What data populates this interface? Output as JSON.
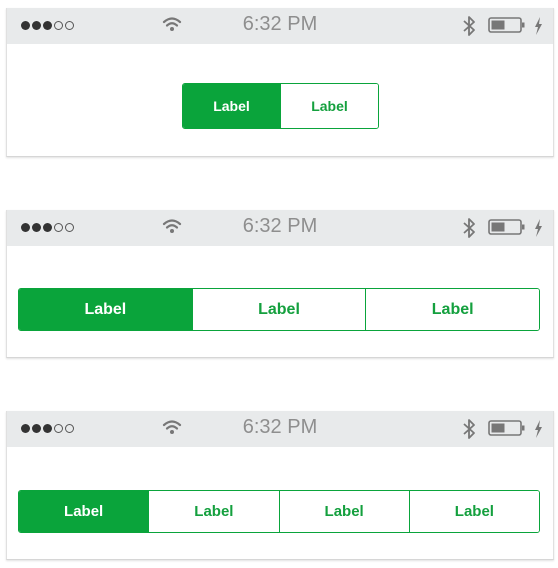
{
  "colors": {
    "accent": "#0aa43b",
    "statusbar_bg": "#e8eaeb",
    "time_text": "#8e8e8e"
  },
  "status_bar": {
    "time": "6:32 PM",
    "signal": [
      "full",
      "full",
      "full",
      "empty",
      "empty"
    ],
    "icons": [
      "wifi-icon",
      "bluetooth-icon",
      "battery-icon",
      "charging-bolt-icon"
    ]
  },
  "screens": [
    {
      "segments": [
        {
          "label": "Label",
          "selected": true
        },
        {
          "label": "Label",
          "selected": false
        }
      ]
    },
    {
      "segments": [
        {
          "label": "Label",
          "selected": true
        },
        {
          "label": "Label",
          "selected": false
        },
        {
          "label": "Label",
          "selected": false
        }
      ]
    },
    {
      "segments": [
        {
          "label": "Label",
          "selected": true
        },
        {
          "label": "Label",
          "selected": false
        },
        {
          "label": "Label",
          "selected": false
        },
        {
          "label": "Label",
          "selected": false
        }
      ]
    }
  ]
}
